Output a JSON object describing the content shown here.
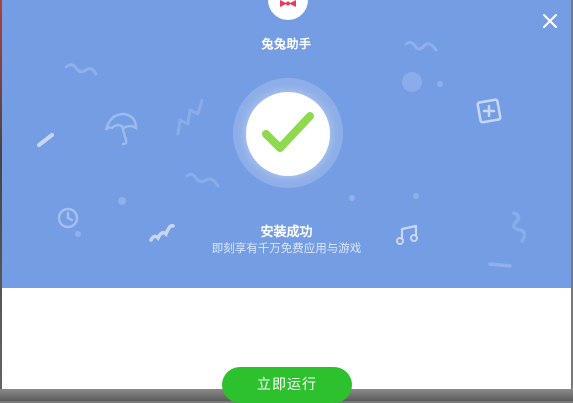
{
  "app": {
    "title": "兔兔助手"
  },
  "status": {
    "title": "安装成功",
    "subtitle": "即刻享有千万免费应用与游戏"
  },
  "actions": {
    "run_label": "立即运行"
  },
  "icons": {
    "close": "close-icon",
    "check": "check-icon",
    "logo": "rabbit-logo-icon"
  },
  "colors": {
    "hero_bg": "#759de3",
    "run_button": "#2ec12e",
    "check": "#8fd94f"
  }
}
